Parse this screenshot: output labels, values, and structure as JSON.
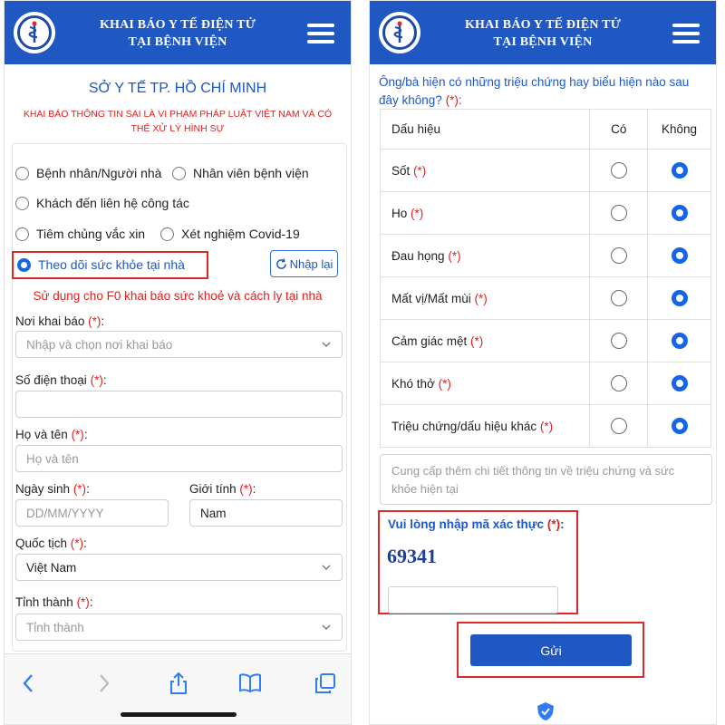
{
  "header": {
    "title_line1": "KHAI BÁO Y TẾ ĐIỆN TỬ",
    "title_line2": "TẠI BỆNH VIỆN",
    "logo_icon": "health-ministry-logo-icon",
    "menu_icon": "hamburger-menu-icon"
  },
  "colors": {
    "primary": "#1f57c3",
    "danger": "#e01f1f",
    "radio_on": "#1565e8"
  },
  "left": {
    "org_name": "SỞ Y TẾ TP. HỒ CHÍ MINH",
    "warning": "KHAI BÁO THÔNG TIN SAI LÀ VI PHẠM PHÁP LUẬT VIỆT NAM VÀ CÓ THỂ XỬ LÝ HÌNH SỰ",
    "options": {
      "patient": "Bệnh nhân/Người nhà",
      "staff": "Nhân viên bệnh viện",
      "visitor": "Khách đến liên hệ công tác",
      "vaccine": "Tiêm chủng vắc xin",
      "covid_test": "Xét nghiệm Covid-19",
      "home_monitor": "Theo dõi sức khỏe tại nhà"
    },
    "selected_option": "home_monitor",
    "reset_label": "Nhập lại",
    "note": "Sử dụng cho F0 khai báo sức khoẻ và cách ly tại nhà",
    "required_mark": "(*)",
    "fields": {
      "place_label": "Nơi khai báo",
      "place_placeholder": "Nhập và chọn nơi khai báo",
      "phone_label": "Số điện thoại",
      "phone_value": "",
      "name_label": "Họ và tên",
      "name_placeholder": "Họ và tên",
      "dob_label": "Ngày sinh",
      "dob_placeholder": "DD/MM/YYYY",
      "gender_label": "Giới tính",
      "gender_value": "Nam",
      "nationality_label": "Quốc tịch",
      "nationality_value": "Việt Nam",
      "province_label": "Tỉnh thành",
      "province_placeholder": "Tỉnh thành"
    },
    "toolbar": {
      "back_icon": "back-chevron-icon",
      "forward_icon": "forward-chevron-icon",
      "share_icon": "share-icon",
      "bookmarks_icon": "book-icon",
      "tabs_icon": "tabs-icon"
    }
  },
  "right": {
    "question": "Ông/bà hiện có những triệu chứng hay biểu hiện nào sau đây không?",
    "required_mark": "(*)",
    "table": {
      "col_sign": "Dấu hiệu",
      "col_yes": "Có",
      "col_no": "Không",
      "rows": [
        {
          "label": "Sốt",
          "answer": "no"
        },
        {
          "label": "Ho",
          "answer": "no"
        },
        {
          "label": "Đau họng",
          "answer": "no"
        },
        {
          "label": "Mất vị/Mất mùi",
          "answer": "no"
        },
        {
          "label": "Cảm giác mệt",
          "answer": "no"
        },
        {
          "label": "Khó thở",
          "answer": "no"
        },
        {
          "label": "Triệu chứng/dấu hiệu khác",
          "answer": "no"
        }
      ]
    },
    "details_placeholder": "Cung cấp thêm chi tiết thông tin về triệu chứng và sức khỏe hiện tại",
    "captcha_label": "Vui lòng nhập mã xác thực",
    "captcha_code": "69341",
    "captcha_value": "",
    "submit_label": "Gửi"
  }
}
